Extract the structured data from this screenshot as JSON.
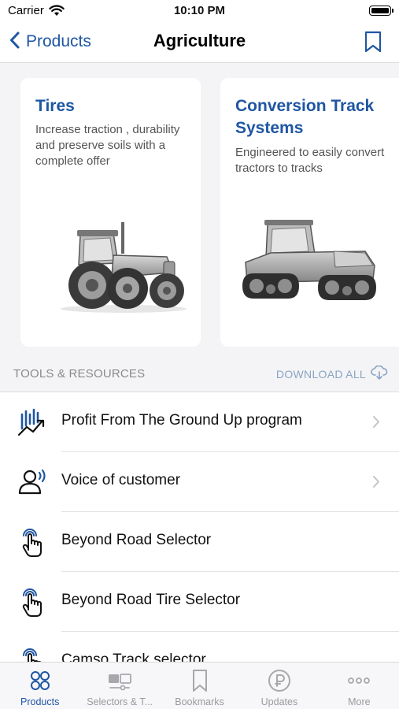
{
  "status_bar": {
    "carrier": "Carrier",
    "time": "10:10 PM"
  },
  "nav": {
    "back_label": "Products",
    "title": "Agriculture"
  },
  "cards": [
    {
      "title": "Tires",
      "description": "Increase traction , durability and preserve soils with a complete offer",
      "image": "wheeled-tractor-image"
    },
    {
      "title": "Conversion Track Systems",
      "description": "Engineered to easily convert tractors to tracks",
      "image": "tracked-tractor-image"
    }
  ],
  "resources": {
    "section_title": "TOOLS & RESOURCES",
    "download_all": "DOWNLOAD ALL",
    "items": [
      {
        "label": "Profit From The Ground Up program",
        "icon": "growth-chart-icon",
        "has_chevron": true
      },
      {
        "label": "Voice of customer",
        "icon": "speaking-person-icon",
        "has_chevron": true
      },
      {
        "label": "Beyond Road Selector",
        "icon": "touch-hand-icon",
        "has_chevron": false
      },
      {
        "label": "Beyond Road Tire Selector",
        "icon": "touch-hand-icon",
        "has_chevron": false
      },
      {
        "label": "Camso Track selector",
        "icon": "touch-hand-icon",
        "has_chevron": false
      }
    ]
  },
  "tab_bar": {
    "tabs": [
      {
        "label": "Products",
        "icon": "grid-circles-icon",
        "active": true
      },
      {
        "label": "Selectors & T...",
        "icon": "selectors-icon",
        "active": false
      },
      {
        "label": "Bookmarks",
        "icon": "bookmark-icon",
        "active": false
      },
      {
        "label": "Updates",
        "icon": "updates-icon",
        "active": false
      },
      {
        "label": "More",
        "icon": "more-dots-icon",
        "active": false
      }
    ]
  },
  "colors": {
    "accent": "#1f56a3",
    "inactive": "#9a9a9e",
    "background": "#f4f4f6"
  }
}
